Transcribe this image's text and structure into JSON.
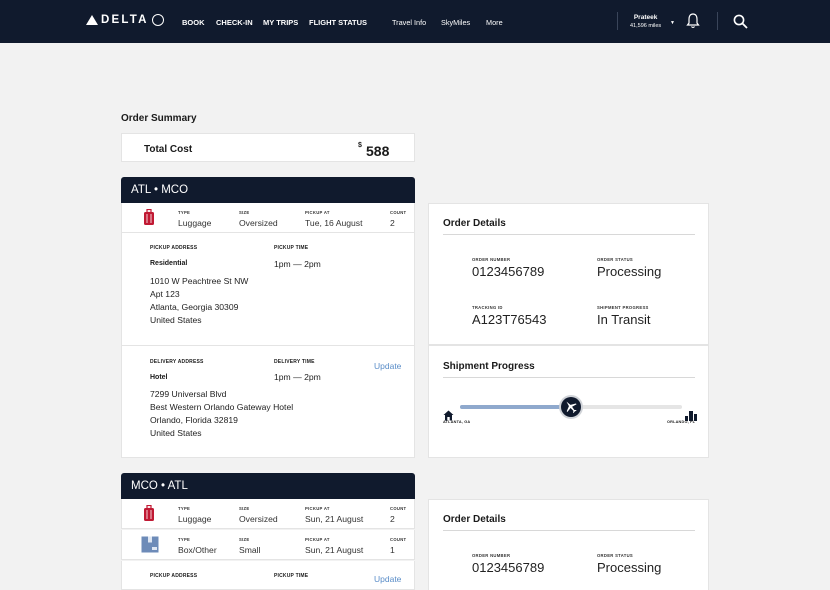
{
  "nav": {
    "brand": "DELTA",
    "links": [
      "BOOK",
      "CHECK-IN",
      "MY TRIPS",
      "FLIGHT STATUS"
    ],
    "secondary_links": [
      "Travel Info",
      "SkyMiles",
      "More"
    ],
    "user_name": "Prateek",
    "user_miles": "41,596 miles",
    "icons": [
      "bell-icon",
      "search-icon"
    ]
  },
  "summary": {
    "title": "Order Summary",
    "total_label": "Total Cost",
    "currency": "$",
    "total": "588"
  },
  "orders": [
    {
      "route": "ATL • MCO",
      "items": [
        {
          "icon": "luggage-icon",
          "type_label": "TYPE",
          "type": "Luggage",
          "size_label": "SIZE",
          "size": "Oversized",
          "pickup_label": "PICKUP AT",
          "pickup": "Tue, 16 August",
          "count_label": "COUNT",
          "count": "2"
        }
      ],
      "pickup": {
        "address_label": "PICKUP ADDRESS",
        "place": "Residential",
        "lines": [
          "1010 W Peachtree St NW",
          "Apt 123",
          "Atlanta, Georgia 30309",
          "United States"
        ],
        "time_label": "PICKUP TIME",
        "time": "1pm — 2pm"
      },
      "delivery": {
        "address_label": "DELIVERY ADDRESS",
        "place": "Hotel",
        "lines": [
          "7299 Universal Blvd",
          "Best Western Orlando Gateway Hotel",
          "Orlando, Florida 32819",
          "United States"
        ],
        "time_label": "DELIVERY TIME",
        "time": "1pm — 2pm",
        "update_label": "Update"
      },
      "details": {
        "title": "Order Details",
        "order_number_label": "ORDER NUMBER",
        "order_number": "0123456789",
        "status_label": "ORDER STATUS",
        "status": "Processing",
        "tracking_label": "TRACKING ID",
        "tracking": "A123T76543",
        "progress_label": "SHIPMENT PROGRESS",
        "progress": "In Transit"
      },
      "shipment": {
        "title": "Shipment Progress",
        "origin": "ATLANTA, GA",
        "destination": "ORLANDO, FL",
        "progress": 0.5
      }
    },
    {
      "route": "MCO • ATL",
      "items": [
        {
          "icon": "luggage-icon",
          "type_label": "TYPE",
          "type": "Luggage",
          "size_label": "SIZE",
          "size": "Oversized",
          "pickup_label": "PICKUP AT",
          "pickup": "Sun, 21 August",
          "count_label": "COUNT",
          "count": "2"
        },
        {
          "icon": "box-icon",
          "type_label": "TYPE",
          "type": "Box/Other",
          "size_label": "SIZE",
          "size": "Small",
          "pickup_label": "PICKUP AT",
          "pickup": "Sun, 21 August",
          "count_label": "COUNT",
          "count": "1"
        }
      ],
      "pickup": {
        "address_label": "PICKUP ADDRESS",
        "time_label": "PICKUP TIME",
        "update_label": "Update"
      },
      "details": {
        "title": "Order Details",
        "order_number_label": "ORDER NUMBER",
        "order_number": "0123456789",
        "status_label": "ORDER STATUS",
        "status": "Processing"
      }
    }
  ],
  "colors": {
    "nav_bg": "#101a2d",
    "accent_red": "#c01933",
    "link_blue": "#5a8dc8",
    "progress_fill": "#8fa9cd"
  }
}
